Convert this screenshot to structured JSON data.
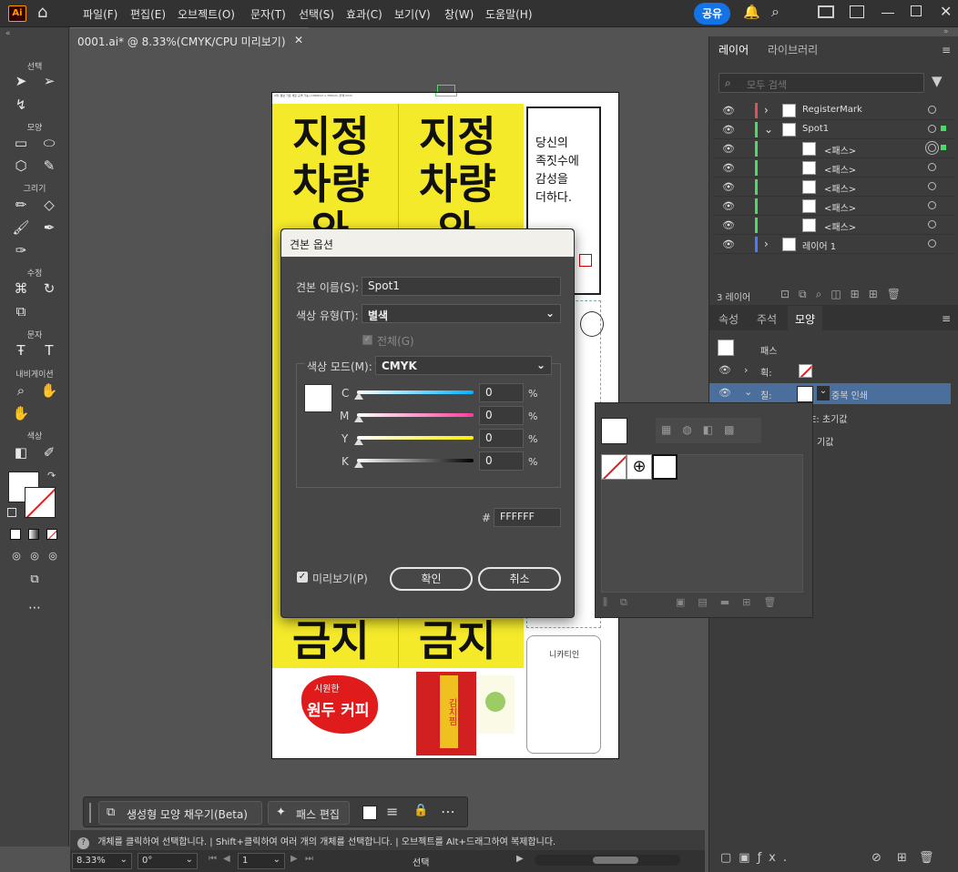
{
  "app": {
    "logo": "Ai"
  },
  "menu": [
    "파일(F)",
    "편집(E)",
    "오브젝트(O)",
    "문자(T)",
    "선택(S)",
    "효과(C)",
    "보기(V)",
    "창(W)",
    "도움말(H)"
  ],
  "share_label": "공유",
  "document_tab": "0001.ai* @ 8.33%(CMYK/CPU 미리보기)",
  "tool_sections": {
    "select": "선택",
    "shape": "모양",
    "draw": "그리기",
    "modify": "수정",
    "type": "문자",
    "navigate": "내비게이션",
    "color": "색상"
  },
  "artwork": {
    "headline_top": [
      "지정",
      "차량"
    ],
    "headline_top_partial": "와",
    "headline_bottom": "금지",
    "poem": [
      "당신의",
      "족짓수에",
      "감성을",
      "더하다."
    ],
    "card_text": [
      "시원한",
      "원두 커피"
    ],
    "menu_title": "니카티인",
    "red_banner": "김치찜",
    "small_header_text": "2개, 점보 가로 세로 규격 가능 | 1600mm x 700mm, 두께 2mm"
  },
  "layers_panel": {
    "tabs": [
      "레이어",
      "라이브러리"
    ],
    "search_placeholder": "모두 검색",
    "rows": [
      {
        "name": "RegisterMark",
        "indent": 0,
        "expand": true,
        "color": "#e0505a"
      },
      {
        "name": "Spot1",
        "indent": 0,
        "expand": true,
        "expanded": true,
        "color": "#4cd964"
      },
      {
        "name": "<패스>",
        "indent": 1,
        "color": "#4cd964",
        "selected": true
      },
      {
        "name": "<패스>",
        "indent": 1,
        "color": "#4cd964"
      },
      {
        "name": "<패스>",
        "indent": 1,
        "color": "#4cd964"
      },
      {
        "name": "<패스>",
        "indent": 1,
        "color": "#4cd964"
      },
      {
        "name": "<패스>",
        "indent": 1,
        "color": "#4cd964"
      },
      {
        "name": "레이어 1",
        "indent": 0,
        "expand": true,
        "color": "#4a7bff"
      }
    ],
    "count": "3 레이어"
  },
  "appearance_panel": {
    "tabs": [
      "속성",
      "주석",
      "모양"
    ],
    "object": "패스",
    "stroke_label": "획:",
    "fill_label": "칠:",
    "fill_extra": "중복 인쇄",
    "opacity_label": "E: 초기값",
    "opacity2_label": "기값"
  },
  "swatch_dialog": {
    "title": "견본 옵션",
    "name_label": "견본 이름(S):",
    "name_value": "Spot1",
    "type_label": "색상 유형(T):",
    "type_value": "별색",
    "global_label": "전체(G)",
    "mode_label": "색상 모드(M):",
    "mode_value": "CMYK",
    "channels": [
      {
        "label": "C",
        "value": "0",
        "colors": "#00b4ff"
      },
      {
        "label": "M",
        "value": "0",
        "colors": "#ff3c9c"
      },
      {
        "label": "Y",
        "value": "0",
        "colors": "#ffee00"
      },
      {
        "label": "K",
        "value": "0",
        "colors": "#000000"
      }
    ],
    "pct": "%",
    "hex_label": "#",
    "hex_value": "FFFFFF",
    "preview_label": "미리보기(P)",
    "ok_label": "확인",
    "cancel_label": "취소"
  },
  "bottom_bar": {
    "generative_label": "생성형 모양 채우기(Beta)",
    "path_edit_label": "패스 편집"
  },
  "status_text": "개체를 클릭하여 선택합니다. | Shift+클릭하여 여러 개의 개체를 선택합니다. | 오브젝트를 Alt+드래그하여 복제합니다.",
  "footer": {
    "zoom": "8.33%",
    "rotation": "0°",
    "artboard": "1",
    "tool": "선택"
  },
  "colors": {
    "accent": "#1473e6",
    "artboard_yellow": "#f5ea2a",
    "selection_green": "#4cd964"
  }
}
